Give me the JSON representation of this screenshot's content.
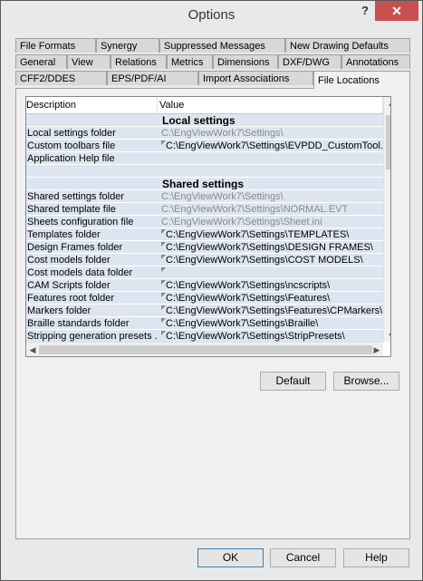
{
  "window": {
    "title": "Options",
    "help_label": "?",
    "close_label": "✕"
  },
  "tabs": {
    "row1": [
      "File Formats",
      "Synergy",
      "Suppressed Messages",
      "New Drawing Defaults"
    ],
    "row2": [
      "General",
      "View",
      "Relations",
      "Metrics",
      "Dimensions",
      "DXF/DWG",
      "Annotations"
    ],
    "row3": [
      "CFF2/DDES",
      "EPS/PDF/AI",
      "Import Associations",
      "File Locations"
    ],
    "active": "File Locations"
  },
  "grid": {
    "columns": [
      "Description",
      "Value"
    ],
    "rows": [
      {
        "desc": "",
        "value": "Local settings",
        "section": true
      },
      {
        "desc": "Local settings folder",
        "value": "C:\\EngViewWork7\\Settings\\",
        "gray": true,
        "edit": false
      },
      {
        "desc": "Custom toolbars file",
        "value": "C:\\EngViewWork7\\Settings\\EVPDD_CustomTool...",
        "gray": false,
        "edit": true
      },
      {
        "desc": "Application Help file",
        "value": "",
        "gray": false,
        "edit": false
      },
      {
        "desc": "",
        "value": "",
        "section": false,
        "blank": true
      },
      {
        "desc": "",
        "value": "Shared settings",
        "section": true
      },
      {
        "desc": "Shared settings folder",
        "value": "C:\\EngViewWork7\\Settings\\",
        "gray": true,
        "edit": false
      },
      {
        "desc": "Shared template file",
        "value": "C:\\EngViewWork7\\Settings\\NORMAL.EVT",
        "gray": true,
        "edit": false
      },
      {
        "desc": "Sheets configuration file",
        "value": "C:\\EngViewWork7\\Settings\\Sheet.ini",
        "gray": true,
        "edit": false
      },
      {
        "desc": "Templates folder",
        "value": "C:\\EngViewWork7\\Settings\\TEMPLATES\\",
        "gray": false,
        "edit": true
      },
      {
        "desc": "Design Frames folder",
        "value": "C:\\EngViewWork7\\Settings\\DESIGN FRAMES\\",
        "gray": false,
        "edit": true
      },
      {
        "desc": "Cost models folder",
        "value": "C:\\EngViewWork7\\Settings\\COST MODELS\\",
        "gray": false,
        "edit": true
      },
      {
        "desc": "Cost models data folder",
        "value": "",
        "gray": false,
        "edit": true
      },
      {
        "desc": "CAM Scripts folder",
        "value": "C:\\EngViewWork7\\Settings\\ncscripts\\",
        "gray": false,
        "edit": true
      },
      {
        "desc": "Features root folder",
        "value": "C:\\EngViewWork7\\Settings\\Features\\",
        "gray": false,
        "edit": true
      },
      {
        "desc": "Markers folder",
        "value": "C:\\EngViewWork7\\Settings\\Features\\CPMarkers\\",
        "gray": false,
        "edit": true
      },
      {
        "desc": "Braille standards folder",
        "value": "C:\\EngViewWork7\\Settings\\Braille\\",
        "gray": false,
        "edit": true
      },
      {
        "desc": "Stripping generation presets ...",
        "value": "C:\\EngViewWork7\\Settings\\StripPresets\\",
        "gray": false,
        "edit": true
      }
    ]
  },
  "buttons": {
    "default": "Default",
    "browse": "Browse...",
    "ok": "OK",
    "cancel": "Cancel",
    "help": "Help"
  },
  "scroll": {
    "up": "▲",
    "down": "▼",
    "left": "◀",
    "right": "▶"
  }
}
